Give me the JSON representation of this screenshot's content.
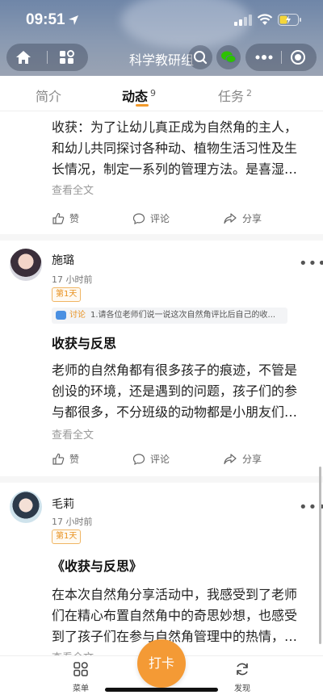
{
  "status_bar": {
    "time": "09:51"
  },
  "nav": {
    "title": "科学教研组"
  },
  "tabs": [
    {
      "label": "简介",
      "count": ""
    },
    {
      "label": "动态",
      "count": "9"
    },
    {
      "label": "任务",
      "count": "2"
    }
  ],
  "colors": {
    "accent": "#f39a2b",
    "header": "#7f92ae"
  },
  "posts": [
    {
      "body": "收获：为了让幼儿真正成为自然角的主人，和幼儿共同探讨各种动、植物生活习性及生长情况，制定一系列的管理方法。是喜湿…",
      "see_all": "查看全文",
      "like": "赞",
      "comment": "评论",
      "share": "分享"
    },
    {
      "author": "施璐",
      "time": "17 小时前",
      "badge": "第1天",
      "discussion_label": "讨论",
      "discussion_text": "1.请各位老师们说一说这次自然角评比后自己的收...",
      "title": "收获与反思",
      "body": "老师的自然角都有很多孩子的痕迹，不管是创设的环境，还是遇到的问题，孩子们的参与都很多，不分班级的动物都是小朋友们…",
      "see_all": "查看全文",
      "like": "赞",
      "comment": "评论",
      "share": "分享"
    },
    {
      "author": "毛莉",
      "time": "17 小时前",
      "badge": "第1天",
      "title": "《收获与反思》",
      "body": "在本次自然角分享活动中，我感受到了老师们在精心布置自然角中的奇思妙想，也感受到了孩子们在参与自然角管理中的热情，…",
      "see_all": "查看全文"
    }
  ],
  "bottom": {
    "menu": "菜单",
    "checkin": "打卡",
    "discover": "发现"
  }
}
